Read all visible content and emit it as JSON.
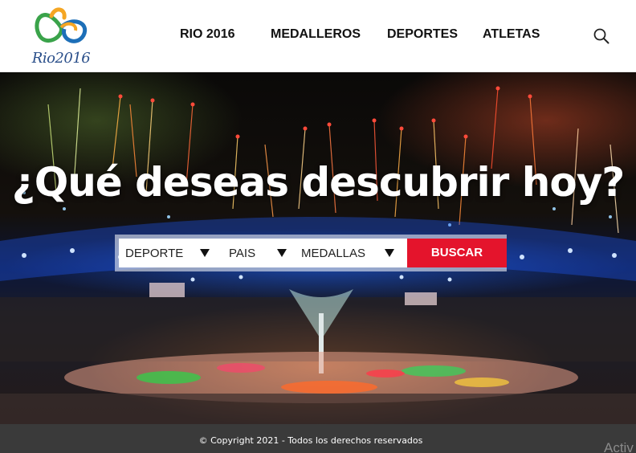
{
  "header": {
    "logo": {
      "alt": "Rio 2016 logo",
      "text": "Rio2016",
      "colors": [
        "#f5a623",
        "#3aa34a",
        "#1d6fb8"
      ]
    },
    "nav": [
      {
        "label": "RIO 2016"
      },
      {
        "label": "MEDALLEROS"
      },
      {
        "label": "DEPORTES"
      },
      {
        "label": "ATLETAS"
      }
    ],
    "search_icon": "search-icon"
  },
  "hero": {
    "title": "¿Qué deseas descubrir hoy?",
    "search": {
      "filters": [
        {
          "label": "DEPORTE",
          "icon": "triangle-down-icon"
        },
        {
          "label": "PAIS",
          "icon": "triangle-down-icon"
        },
        {
          "label": "MEDALLAS",
          "icon": "triangle-down-icon"
        }
      ],
      "button_label": "BUSCAR",
      "button_color": "#e4142c"
    }
  },
  "footer": {
    "copyright": "© Copyright 2021 - Todos los derechos reservados",
    "overlay_text": "Activ"
  }
}
